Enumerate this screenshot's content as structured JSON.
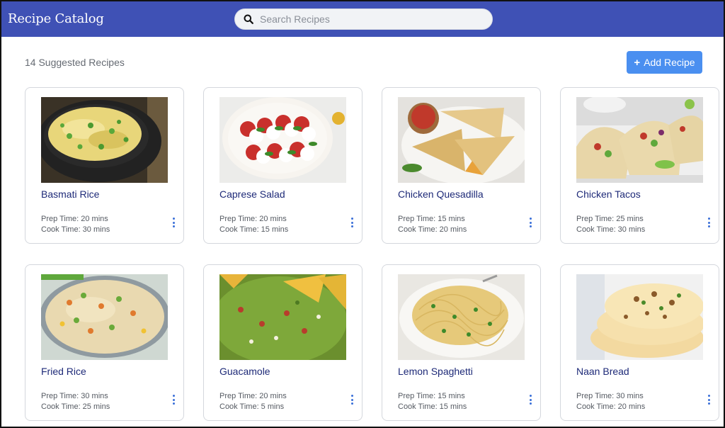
{
  "app": {
    "title": "Recipe Catalog"
  },
  "search": {
    "placeholder": "Search Recipes"
  },
  "header": {
    "count_label": "14 Suggested Recipes",
    "add_button_label": "Add Recipe"
  },
  "colors": {
    "topbar": "#3f51b5",
    "accent": "#4a8ff0",
    "recipe_title": "#1e2a78"
  },
  "recipes": [
    {
      "name": "Basmati Rice",
      "prep": "Prep Time: 20 mins",
      "cook": "Cook Time: 30 mins"
    },
    {
      "name": "Caprese Salad",
      "prep": "Prep Time: 20 mins",
      "cook": "Cook Time: 15 mins"
    },
    {
      "name": "Chicken Quesadilla",
      "prep": "Prep Time: 15 mins",
      "cook": "Cook Time: 20 mins"
    },
    {
      "name": "Chicken Tacos",
      "prep": "Prep Time: 25 mins",
      "cook": "Cook Time: 30 mins"
    },
    {
      "name": "Fried Rice",
      "prep": "Prep Time: 30 mins",
      "cook": "Cook Time: 25 mins"
    },
    {
      "name": "Guacamole",
      "prep": "Prep Time: 20 mins",
      "cook": "Cook Time: 5 mins"
    },
    {
      "name": "Lemon Spaghetti",
      "prep": "Prep Time: 15 mins",
      "cook": "Cook Time: 15 mins"
    },
    {
      "name": "Naan Bread",
      "prep": "Prep Time: 30 mins",
      "cook": "Cook Time: 20 mins"
    }
  ]
}
